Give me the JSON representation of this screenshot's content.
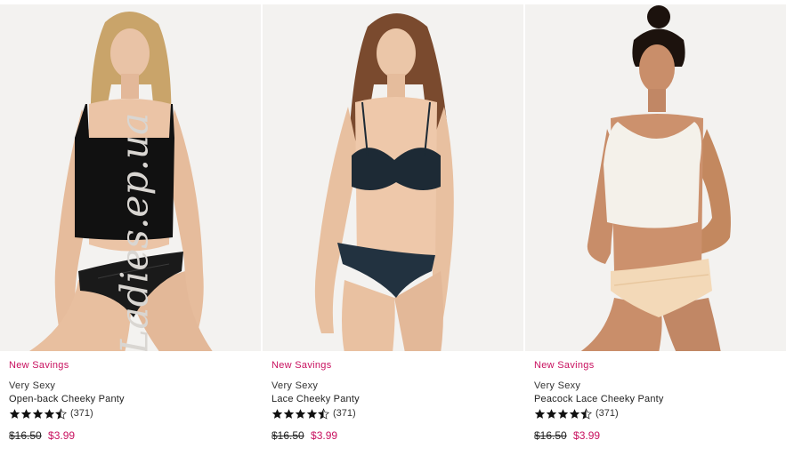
{
  "products": [
    {
      "promo": "New Savings",
      "brand": "Very Sexy",
      "name": "Open-back Cheeky Panty",
      "rating": 4.5,
      "review_count": "(371)",
      "original_price": "$16.50",
      "sale_price": "$3.99",
      "colors": {
        "top": "#111111",
        "bottom": "#1a1a1a"
      }
    },
    {
      "promo": "New Savings",
      "brand": "Very Sexy",
      "name": "Lace Cheeky Panty",
      "rating": 4.5,
      "review_count": "(371)",
      "original_price": "$16.50",
      "sale_price": "$3.99",
      "colors": {
        "top": "#1d2a35",
        "bottom": "#223240"
      }
    },
    {
      "promo": "New Savings",
      "brand": "Very Sexy",
      "name": "Peacock Lace Cheeky Panty",
      "rating": 4.5,
      "review_count": "(371)",
      "original_price": "$16.50",
      "sale_price": "$3.99",
      "colors": {
        "top": "#f4f1ea",
        "bottom": "#f3d9b8"
      }
    }
  ],
  "watermark": "Ladies.ep.ua",
  "theme": {
    "accent": "#c8115f",
    "star": "#111111"
  }
}
